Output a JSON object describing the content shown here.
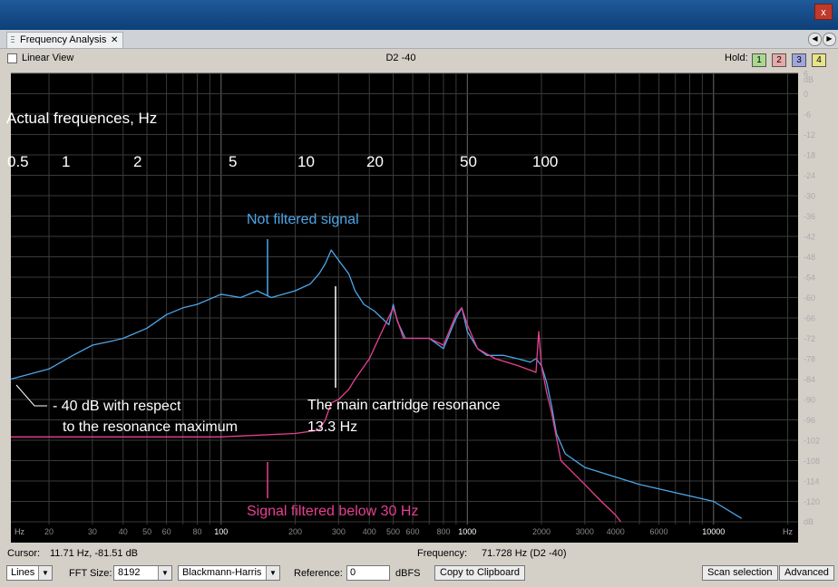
{
  "window": {
    "close_label": "x"
  },
  "tab": {
    "label": "Frequency Analysis",
    "close": "✕",
    "nav_left": "◀",
    "nav_right": "▶"
  },
  "toolbar": {
    "linear_view_label": "Linear View",
    "current_label": "D2 -40",
    "hold_label": "Hold:",
    "hold_buttons": [
      "1",
      "2",
      "3",
      "4"
    ]
  },
  "colors": {
    "hold": [
      "#a9d98f",
      "#e9a9a9",
      "#9fa6e0",
      "#e8e48a"
    ],
    "blue_trace": "#4da6e8",
    "pink_trace": "#e8408f"
  },
  "chart_data": {
    "type": "line",
    "x_scale": "log",
    "xlim": [
      14,
      22050
    ],
    "ylim": [
      -126,
      6
    ],
    "x_unit_label": "Hz",
    "x_ticks": [
      "20",
      "30",
      "40",
      "50",
      "60",
      "80",
      "100",
      "200",
      "300",
      "400",
      "500",
      "600",
      "800",
      "1000",
      "2000",
      "3000",
      "4000",
      "6000",
      "10000"
    ],
    "x_tick_values": [
      20,
      30,
      40,
      50,
      60,
      80,
      100,
      200,
      300,
      400,
      500,
      600,
      800,
      1000,
      2000,
      3000,
      4000,
      6000,
      10000
    ],
    "y_unit_label": "dB",
    "y_ticks": [
      "6",
      "0",
      "-6",
      "-12",
      "-18",
      "-24",
      "-30",
      "-36",
      "-42",
      "-48",
      "-54",
      "-60",
      "-66",
      "-72",
      "-78",
      "-84",
      "-90",
      "-96",
      "-102",
      "-108",
      "-114",
      "-120"
    ],
    "y_tick_values": [
      6,
      0,
      -6,
      -12,
      -18,
      -24,
      -30,
      -36,
      -42,
      -48,
      -54,
      -60,
      -66,
      -72,
      -78,
      -84,
      -90,
      -96,
      -102,
      -108,
      -114,
      -120
    ],
    "grid": true,
    "series": [
      {
        "x": [
          14,
          20,
          25,
          30,
          35,
          40,
          50,
          60,
          70,
          80,
          100,
          120,
          140,
          160,
          200,
          230,
          250,
          265,
          280,
          300,
          330,
          350,
          380,
          420,
          480,
          500,
          520,
          560,
          600,
          700,
          800,
          900,
          950,
          1000,
          1100,
          1200,
          1400,
          1600,
          1800,
          1900,
          2000,
          2100,
          2200,
          2300,
          2500,
          3000,
          5000,
          10000,
          13000
        ],
        "y": [
          -84,
          -81,
          -77,
          -74,
          -73,
          -72,
          -69,
          -65,
          -63,
          -62,
          -59,
          -60,
          -58,
          -60,
          -58,
          -56,
          -53,
          -50,
          -46,
          -49,
          -53,
          -58,
          -62,
          -64,
          -68,
          -62,
          -67,
          -72,
          -72,
          -72,
          -75,
          -66,
          -63,
          -70,
          -75,
          -77,
          -77,
          -78,
          -79,
          -78,
          -80,
          -85,
          -92,
          -100,
          -106,
          -110,
          -115,
          -120,
          -125
        ]
      },
      {
        "x": [
          14,
          100,
          200,
          250,
          265,
          280,
          300,
          330,
          350,
          400,
          450,
          500,
          550,
          600,
          700,
          800,
          900,
          950,
          1000,
          1100,
          1300,
          1600,
          1900,
          1950,
          2000,
          2050,
          2100,
          2200,
          2400,
          3000,
          3500,
          4000,
          4200
        ],
        "y": [
          -101,
          -101,
          -100,
          -99,
          -96,
          -91,
          -90,
          -87,
          -84,
          -78,
          -70,
          -63,
          -72,
          -72,
          -72,
          -74,
          -65,
          -63,
          -68,
          -75,
          -78,
          -80,
          -82,
          -70,
          -80,
          -84,
          -88,
          -94,
          -108,
          -115,
          -120,
          -124,
          -126
        ]
      }
    ]
  },
  "annotations": {
    "actual_freq_title": "Actual frequences, Hz",
    "actual_freqs": [
      "0.5",
      "1",
      "2",
      "5",
      "10",
      "20",
      "50",
      "100"
    ],
    "not_filtered": "Not filtered signal",
    "minus40_line1": "- 40 dB with respect",
    "minus40_line2": "to the resonance maximum",
    "resonance_line1": "The main cartridge resonance",
    "resonance_line2": "13.3 Hz",
    "filtered": "Signal filtered below 30 Hz"
  },
  "status": {
    "cursor_label": "Cursor:",
    "cursor_value": "11.71 Hz, -81.51 dB",
    "frequency_label": "Frequency:",
    "frequency_value": "71.728 Hz (D2 -40)"
  },
  "controls": {
    "display_mode": "Lines",
    "fft_label": "FFT Size:",
    "fft_value": "8192",
    "window_value": "Blackmann-Harris",
    "reference_label": "Reference:",
    "reference_value": "0",
    "dbfs_label": "dBFS",
    "copy_label": "Copy to Clipboard",
    "scan_label": "Scan selection",
    "advanced_label": "Advanced",
    "dropdown_arrow": "▼"
  }
}
